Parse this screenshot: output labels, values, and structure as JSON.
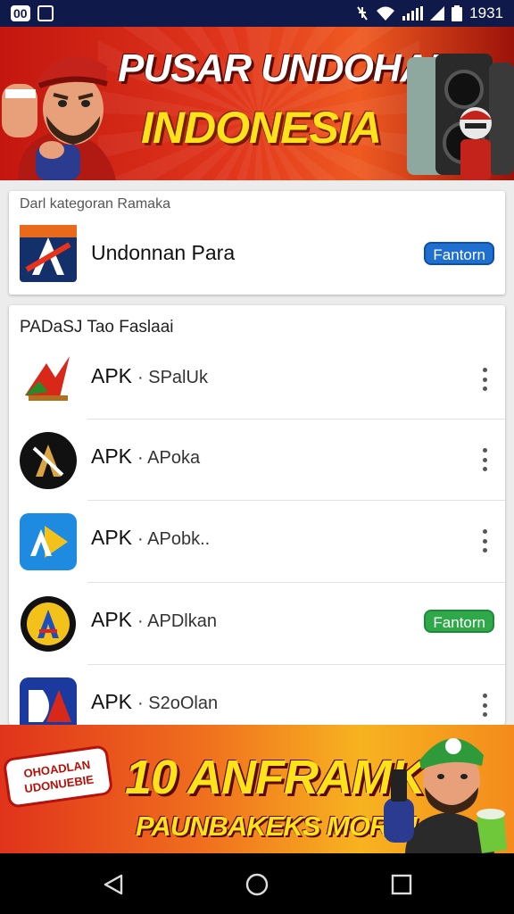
{
  "status_bar": {
    "left_badge": "00",
    "time": "1931",
    "icons": [
      "notification-badge-icon",
      "image-icon",
      "mute-icon",
      "wifi-icon",
      "signal-icon",
      "battery-icon"
    ]
  },
  "top_banner": {
    "title_line1": "PUSAR UNDOHAN",
    "title_line2": "INDONESIA",
    "colors": {
      "background": "#d9261a",
      "title1": "#ffffff",
      "title2": "#ffe21a"
    }
  },
  "featured_card": {
    "header": "Darl kategoran Ramaka",
    "item": {
      "name": "Undonnan Para",
      "button": "Fantorn",
      "icon": "app-a-icon"
    }
  },
  "list_card": {
    "header": "PADaSJ Tao Faslaai",
    "items": [
      {
        "title": "APK",
        "subtitle": "SPalUk",
        "action": "more",
        "icon": "red-a-logo-icon"
      },
      {
        "title": "APK",
        "subtitle": "APoka",
        "action": "more",
        "icon": "black-a-logo-icon"
      },
      {
        "title": "APK",
        "subtitle": "APobk..",
        "action": "more",
        "icon": "blue-play-a-icon"
      },
      {
        "title": "APK",
        "subtitle": "APDlkan",
        "action": "button",
        "button": "Fantorn",
        "icon": "badge-a-logo-icon"
      },
      {
        "title": "APK",
        "subtitle": "S2oOlan",
        "action": "more",
        "icon": "da-logo-icon"
      }
    ]
  },
  "bottom_banner": {
    "sticker": "OHOADLAN UDONUEBIE",
    "line1": "10 ANFRAMK",
    "line2": "PAUNBAKEKS MORO!",
    "colors": {
      "background": "#f07a1e",
      "text": "#ffe21a"
    }
  },
  "nav_bar": {
    "buttons": [
      "back-icon",
      "home-icon",
      "recents-icon"
    ]
  }
}
